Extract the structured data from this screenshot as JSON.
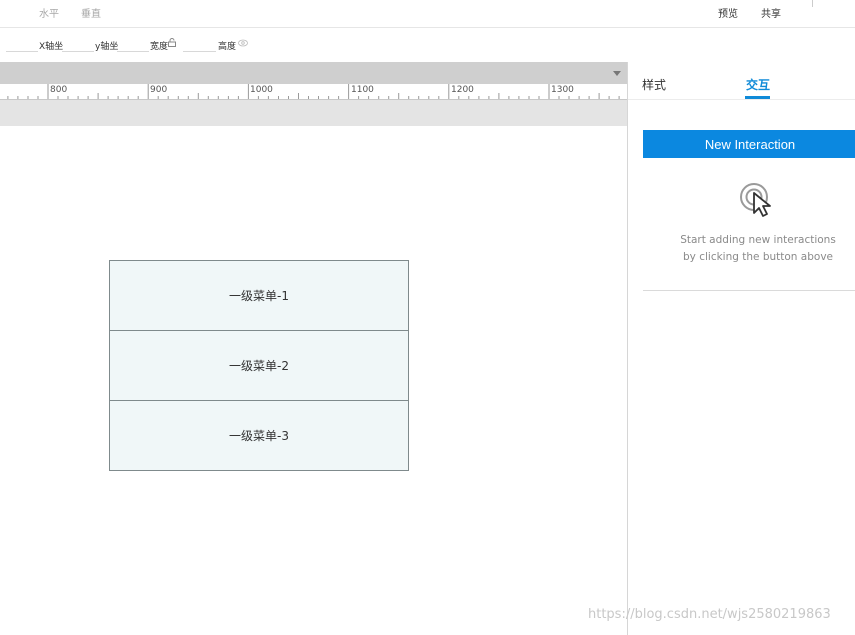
{
  "toolbar": {
    "align_horizontal": "水平",
    "align_vertical": "垂直",
    "preview": "预览",
    "share": "共享"
  },
  "properties": {
    "x_label": "X轴坐",
    "y_label": "y轴坐",
    "width_label": "宽度",
    "height_label": "高度",
    "lock_icon": "lock-icon",
    "eye_icon": "eye-icon"
  },
  "ruler": {
    "ticks": [
      "800",
      "900",
      "1000",
      "1100",
      "1200",
      "1300"
    ]
  },
  "canvas": {
    "menu_items": [
      "一级菜单-1",
      "一级菜单-2",
      "一级菜单-3"
    ]
  },
  "panel": {
    "tabs": [
      "样式",
      "交互"
    ],
    "active_tab": "交互",
    "new_interaction_button": "New Interaction",
    "hint_line_1": "Start adding new interactions",
    "hint_line_2": "by clicking the button above",
    "hint_icon": "tap-cursor-icon",
    "accent_color": "#0b88e0"
  },
  "watermark": "https://blog.csdn.net/wjs2580219863"
}
